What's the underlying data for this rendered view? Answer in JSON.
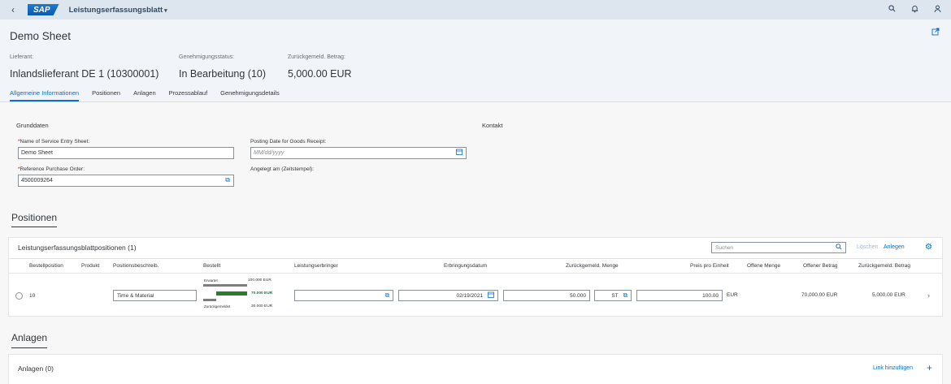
{
  "shell": {
    "back_icon": "chevron-left-icon",
    "logo": "SAP",
    "title": "Leistungserfassungsblatt",
    "title_caret": "▾",
    "right_icons": [
      "search-icon",
      "bell-icon",
      "user-icon"
    ]
  },
  "header": {
    "title": "Demo Sheet",
    "attributes": [
      {
        "label": "Lieferant:",
        "value": "Inlandslieferant DE 1 (10300001)"
      },
      {
        "label": "Genehmigungsstatus:",
        "value": "In Bearbeitung (10)"
      },
      {
        "label": "Zurückgemeld. Betrag:",
        "value": "5,000.00  EUR"
      }
    ],
    "tabs": [
      {
        "label": "Allgemeine Informationen",
        "active": true
      },
      {
        "label": "Positionen",
        "active": false
      },
      {
        "label": "Anlagen",
        "active": false
      },
      {
        "label": "Prozessablauf",
        "active": false
      },
      {
        "label": "Genehmigungsdetails",
        "active": false
      }
    ]
  },
  "general": {
    "grunddaten_label": "Grunddaten",
    "kontakt_label": "Kontakt",
    "name_label": "Name of Service Entry Sheet:",
    "name_value": "Demo Sheet",
    "po_label": "Reference Purchase Order:",
    "po_value": "4500009264",
    "posting_label": "Posting Date for Goods Receipt:",
    "posting_placeholder": "MM/dd/yyyy",
    "created_label": "Angelegt am (Zeitstempel):"
  },
  "positions": {
    "section_title": "Positionen",
    "table_title": "Leistungserfassungsblattpositionen (1)",
    "search_placeholder": "Suchen",
    "delete_label": "Löschen",
    "create_label": "Anlegen",
    "columns": [
      "Bestellposition",
      "Produkt",
      "Positionsbeschreib.",
      "Bestellt",
      "Leistungserbringer",
      "Erbringungsdatum",
      "Zurückgemeld. Menge",
      "Preis pro Einheit",
      "Offene Menge",
      "Offener Betrag",
      "Zurückgemeld. Betrag"
    ],
    "row": {
      "position": "10",
      "description": "Time & Material",
      "ordered": {
        "expected_label": "Erwartet",
        "expected_value": "100.000 EUR",
        "ordered_value": "70.000 EUR",
        "reported_label": "Zurückgemeldet",
        "reported_value": "30.000 EUR"
      },
      "provider": "",
      "date": "02/19/2021",
      "quantity": "50.000",
      "unit": "ST",
      "price": "100.00",
      "price_currency": "EUR",
      "open_quantity": "",
      "open_amount": "70,000.00  EUR",
      "reported_amount": "5,000.00  EUR"
    }
  },
  "attachments": {
    "section_title": "Anlagen",
    "table_title": "Anlagen (0)",
    "add_link_label": "Link hinzufügen"
  },
  "colors": {
    "accent": "#0a6ed1",
    "shell_bg": "#dde5ef",
    "header_bg": "#f1f4f8",
    "positive": "#107e3e"
  }
}
